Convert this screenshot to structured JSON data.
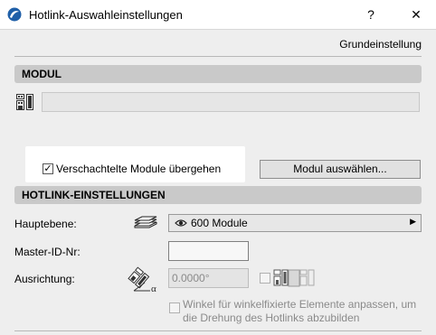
{
  "window": {
    "title": "Hotlink-Auswahleinstellungen",
    "help": "?",
    "close": "✕"
  },
  "preset": {
    "label": "Grundeinstellung"
  },
  "modul": {
    "header": "MODUL",
    "field_value": "",
    "checkbox_label": "Verschachtelte Module übergehen",
    "checkbox_checked": "✓",
    "select_button": "Modul auswählen..."
  },
  "hotlink": {
    "header": "HOTLINK-EINSTELLUNGEN",
    "layer_label": "Hauptebene:",
    "layer_value": "600 Module",
    "layer_arrow": "▶",
    "master_id_label": "Master-ID-Nr:",
    "master_id_value": "",
    "orientation_label": "Ausrichtung:",
    "orientation_value": "0.0000°",
    "orientation_alpha": "α",
    "angle_fix_line1": "Winkel für winkelfixierte Elemente anpassen, um",
    "angle_fix_line2": "die Drehung des Hotlinks abzubilden"
  },
  "colors": {
    "section_header": "#c9c9c9",
    "window_bg": "#eeeeee"
  }
}
